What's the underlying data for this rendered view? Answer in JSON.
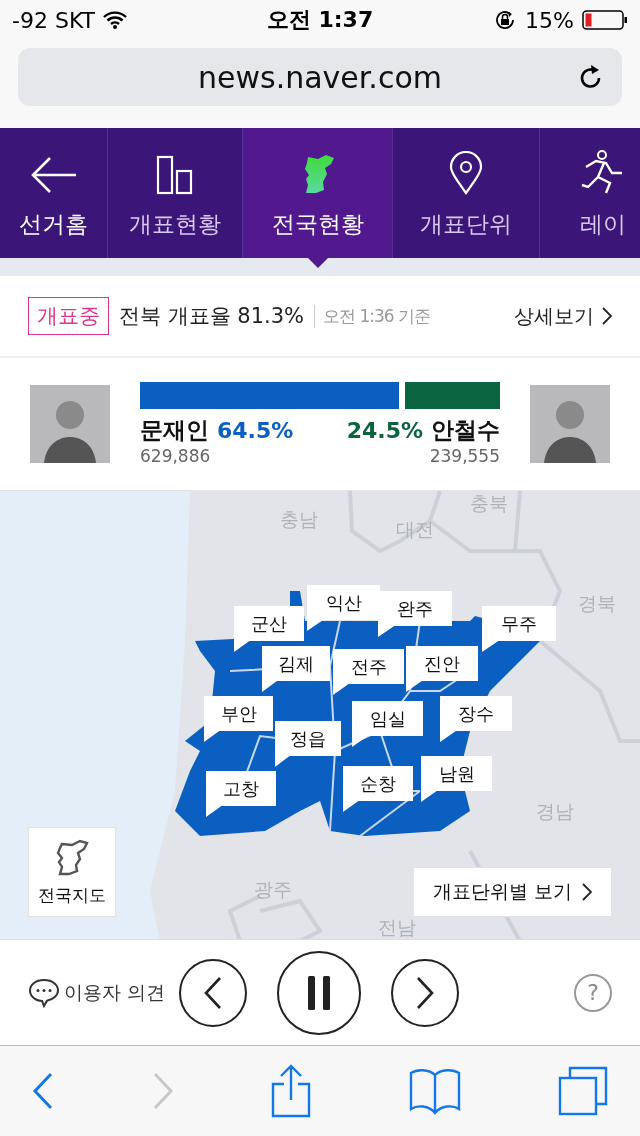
{
  "status_bar": {
    "carrier": "-92 SKT",
    "time": "오전 1:37",
    "battery": "15%"
  },
  "address_bar": {
    "url": "news.naver.com"
  },
  "nav_tabs": [
    {
      "label": "선거홈",
      "kind": "back",
      "selected": false
    },
    {
      "label": "개표현황",
      "kind": "bars",
      "selected": false
    },
    {
      "label": "전국현황",
      "kind": "map",
      "selected": true
    },
    {
      "label": "개표단위",
      "kind": "pin",
      "selected": false
    },
    {
      "label": "레이",
      "kind": "runner",
      "selected": false
    }
  ],
  "count_info": {
    "badge": "개표중",
    "rate": "전북 개표율 81.3%",
    "time": "오전 1:36 기준",
    "detail_link": "상세보기"
  },
  "candidates": [
    {
      "name": "문재인",
      "percent": "64.5%",
      "votes": "629,886",
      "color": "#0a5fc1",
      "level": 0.72
    },
    {
      "name": "안철수",
      "percent": "24.5%",
      "votes": "239,555",
      "color": "#0a6440",
      "level": 0.265
    }
  ],
  "map": {
    "districts": [
      "군산",
      "익산",
      "완주",
      "무주",
      "김제",
      "전주",
      "진안",
      "부안",
      "정읍",
      "임실",
      "장수",
      "고창",
      "순창",
      "남원"
    ],
    "neighbor_regions": [
      "충남",
      "대전",
      "충북",
      "경북",
      "경남",
      "광주",
      "전남"
    ],
    "national_map_button": "전국지도",
    "unit_view_button": "개표단위별 보기"
  },
  "controls": {
    "feedback": "이용자 의견",
    "help": "?"
  },
  "browser_toolbar": {
    "back_disabled": false,
    "forward_disabled": true
  }
}
